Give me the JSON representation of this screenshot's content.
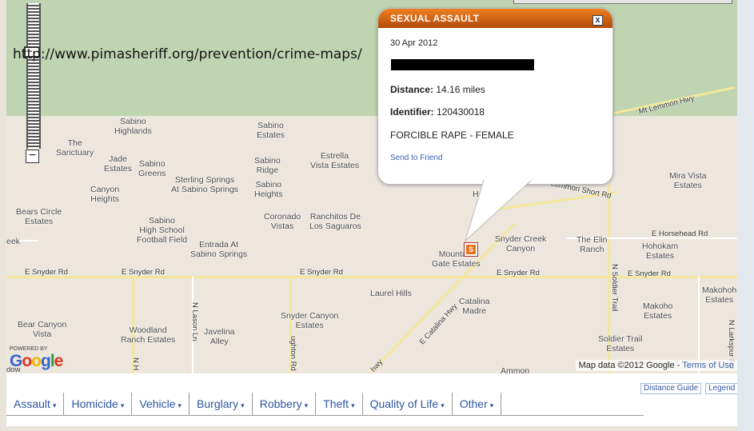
{
  "url_overlay": "http://www.pimasheriff.org/prevention/crime-maps/",
  "zoom": {
    "out_label": "−"
  },
  "map": {
    "places": [
      {
        "name": "Sabino\nHighlands"
      },
      {
        "name": "The\nSanctuary"
      },
      {
        "name": "Jade\nEstates"
      },
      {
        "name": "Sabino\nGreens"
      },
      {
        "name": "Sabino\nEstates"
      },
      {
        "name": "Estrella\nVista Estates"
      },
      {
        "name": "Sabino\nRidge"
      },
      {
        "name": "Sterling Springs\nAt Sabino Springs"
      },
      {
        "name": "Sabino\nHeights"
      },
      {
        "name": "Canyon\nHeights"
      },
      {
        "name": "Bears Circle\nEstates"
      },
      {
        "name": "Sabino\nHigh School\nFootball Field"
      },
      {
        "name": "Coronado\nVistas"
      },
      {
        "name": "Ranchitos De\nLos Saguaros"
      },
      {
        "name": "Entrada At\nSabino Springs"
      },
      {
        "name": "Mountain\nGate Estates"
      },
      {
        "name": "Snyder Creek\nCanyon"
      },
      {
        "name": "The Elin\nRanch"
      },
      {
        "name": "Hohokam\nEstates"
      },
      {
        "name": "Mira Vista\nEstates"
      },
      {
        "name": "Laurel Hills"
      },
      {
        "name": "Catalina\nMadre"
      },
      {
        "name": "Snyder Canyon\nEstates"
      },
      {
        "name": "Bear Canyon\nVista"
      },
      {
        "name": "Woodland\nRanch Estates"
      },
      {
        "name": "Javelina\nAlley"
      },
      {
        "name": "Makohoh\nEstates"
      },
      {
        "name": "Makoho\nEstates"
      },
      {
        "name": "Soldier Trail\nEstates"
      },
      {
        "name": "Ammon"
      },
      {
        "name": "eek"
      },
      {
        "name": "Hom"
      }
    ],
    "roads": {
      "snyder": "E Snyder Rd",
      "catalina": "E Catalina Hwy",
      "lemmon": "Mt Lemmon Hwy",
      "lemmon_short": "Lemmon Short Rd",
      "horsehead": "E Horsehead Rd",
      "soldier": "N Soldier Trail",
      "larkspur": "N Larkspur Rd",
      "lason": "N Lason Ln",
      "houghton": "ughton Rd",
      "hwy": "hwy",
      "n_h": "N H"
    },
    "attribution": "Map data ©2012 Google - ",
    "terms": "Terms of Use",
    "powered_by": "POWERED BY",
    "google": "Google",
    "edge_label": "dow",
    "marker_letter": "S"
  },
  "popup": {
    "title": "SEXUAL ASSAULT",
    "close": "x",
    "date": "30 Apr 2012",
    "distance_label": "Distance:",
    "distance_value": "14.16 miles",
    "identifier_label": "Identifier:",
    "identifier_value": "120430018",
    "description": "FORCIBLE RAPE - FEMALE",
    "send_link": "Send to Friend"
  },
  "panel": {
    "distance_guide": "Distance Guide",
    "legend": "Legend",
    "tabs": [
      "Assault",
      "Homicide",
      "Vehicle",
      "Burglary",
      "Robbery",
      "Theft",
      "Quality of Life",
      "Other"
    ],
    "caret": "▾"
  },
  "colors": {
    "accent_orange": "#e8731d",
    "tab_blue": "#2d56a0",
    "forest": "#bfd5b2",
    "road": "#f5e79a"
  }
}
